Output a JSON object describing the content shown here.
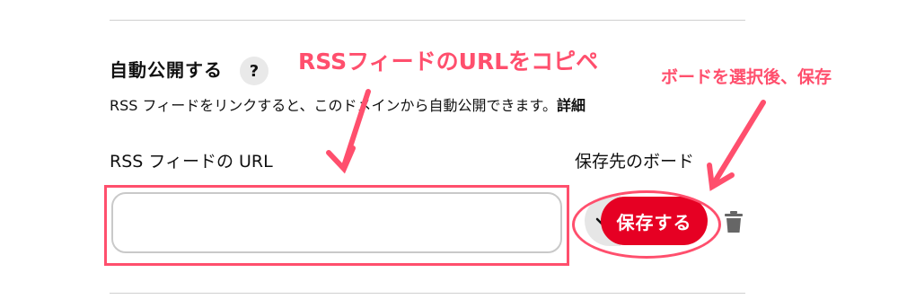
{
  "section": {
    "title": "自動公開する",
    "help_label": "?",
    "description": "RSS フィードをリンクすると、このドメインから自動公開できます。",
    "details_link": "詳細"
  },
  "rss_field": {
    "label": "RSS フィードの URL",
    "value": "",
    "placeholder": ""
  },
  "board_field": {
    "label": "保存先のボード",
    "save_button": "保存する"
  },
  "annotations": {
    "copy_note": "RSSフィードのURLをコピペ",
    "save_note": "ボードを選択後、保存"
  },
  "colors": {
    "accent": "#e60023",
    "annotation": "#ff4f6d",
    "divider": "#cfcfcf"
  }
}
